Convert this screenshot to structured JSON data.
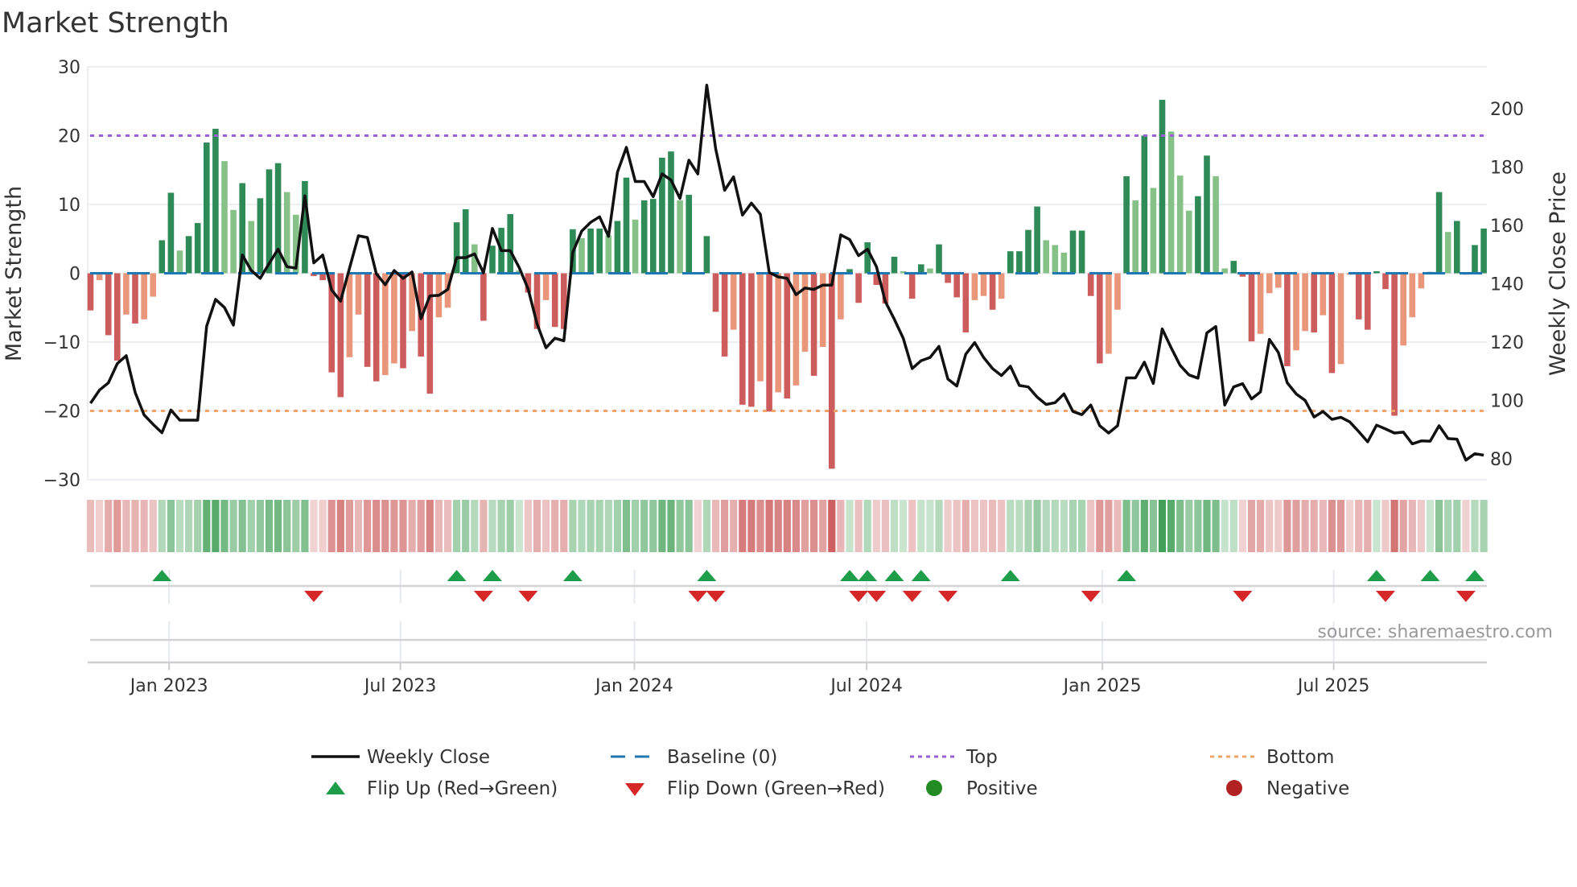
{
  "title": "Market Strength",
  "source": "source: sharemaestro.com",
  "chart_data": {
    "type": "bar",
    "title": "Market Strength",
    "ylabel": "Market Strength",
    "ylabel_right": "Weekly Close Price",
    "ylim": [
      -30,
      30
    ],
    "ylim_right": [
      72.8,
      214.3
    ],
    "yticks": [
      {
        "v": 30,
        "label": "30"
      },
      {
        "v": 20,
        "label": "20"
      },
      {
        "v": 10,
        "label": "10"
      },
      {
        "v": 0,
        "label": "0"
      },
      {
        "v": -10,
        "label": "−10"
      },
      {
        "v": -20,
        "label": "−20"
      },
      {
        "v": -30,
        "label": "−30"
      }
    ],
    "yticks_right": [
      {
        "v": 200,
        "label": "200"
      },
      {
        "v": 180,
        "label": "180"
      },
      {
        "v": 160,
        "label": "160"
      },
      {
        "v": 140,
        "label": "140"
      },
      {
        "v": 120,
        "label": "120"
      },
      {
        "v": 100,
        "label": "100"
      },
      {
        "v": 80,
        "label": "80"
      }
    ],
    "x_unit": "week index",
    "xticks": [
      {
        "x": 8.8,
        "label": "Jan 2023"
      },
      {
        "x": 34.7,
        "label": "Jul 2023"
      },
      {
        "x": 60.9,
        "label": "Jan 2024"
      },
      {
        "x": 86.9,
        "label": "Jul 2024"
      },
      {
        "x": 113.3,
        "label": "Jan 2025"
      },
      {
        "x": 139.2,
        "label": "Jul 2025"
      }
    ],
    "top_level": 20,
    "bottom_level": -20,
    "baseline": 0,
    "strength": [
      -5.4,
      -1,
      -9,
      -12.7,
      -6,
      -7.3,
      -6.7,
      -3.4,
      4.8,
      11.7,
      3.3,
      5.4,
      7.3,
      19,
      21,
      16.3,
      9.2,
      13.1,
      7.6,
      10.9,
      15.1,
      16,
      11.8,
      8.5,
      13.4,
      -0.4,
      -1,
      -14.4,
      -18,
      -12.2,
      -6,
      -13.6,
      -15.7,
      -14.8,
      -13.1,
      -13.8,
      -8.4,
      -12.1,
      -17.5,
      -6.4,
      -5,
      7.4,
      9.3,
      4.2,
      -6.9,
      4,
      6.6,
      8.6,
      0.4,
      -2.8,
      -8.1,
      -3.9,
      -7.8,
      -8.1,
      6.4,
      5.1,
      6.5,
      6.5,
      5.5,
      7.6,
      13.9,
      7.8,
      10.6,
      10.8,
      16.8,
      17.7,
      10.6,
      11.4,
      -0.1,
      5.4,
      -5.6,
      -12.1,
      -8.2,
      -19.1,
      -19.4,
      -15.7,
      -20.1,
      -17.3,
      -18.2,
      -16.3,
      -11.4,
      -14.9,
      -10.7,
      -28.4,
      -6.7,
      0.6,
      -4.3,
      4.5,
      -1.7,
      -4.4,
      2.4,
      0.3,
      -3.7,
      1.3,
      0.7,
      4.2,
      -1.4,
      -3.5,
      -8.6,
      -3.9,
      -3.3,
      -5.3,
      -3.7,
      3.2,
      3.2,
      6.3,
      9.7,
      4.8,
      4.1,
      3.0,
      6.2,
      6.2,
      -3.3,
      -13.1,
      -11.7,
      -5.3,
      14.1,
      10.6,
      20.0,
      12.4,
      25.2,
      20.6,
      14.2,
      9.1,
      11.2,
      17.1,
      14.1,
      0.7,
      1.8,
      -0.5,
      -9.9,
      -8.8,
      -2.9,
      -2.1,
      -13.5,
      -11.2,
      -8.4,
      -8.6,
      -6.1,
      -14.5,
      -13.2,
      -0.2,
      -6.7,
      -8.2,
      0.3,
      -2.3,
      -20.7,
      -10.5,
      -6.4,
      -2.2,
      0.2,
      11.8,
      6.0,
      7.6,
      -0.2,
      4.1,
      6.5
    ],
    "weekly_close": [
      99,
      103.5,
      106,
      112.6,
      115.3,
      102.7,
      95,
      91.8,
      88.9,
      96.7,
      93.2,
      93.2,
      93.2,
      125.4,
      134.6,
      131.8,
      125.8,
      149.8,
      144.5,
      141.8,
      146.9,
      151.8,
      145.8,
      145.3,
      170.1,
      147.1,
      149.8,
      137.8,
      134,
      145.3,
      156.4,
      155.8,
      143.4,
      139.6,
      144.5,
      141.8,
      144,
      128,
      135.8,
      136,
      138,
      148.9,
      148.9,
      150.2,
      143.7,
      158.9,
      151.3,
      151.3,
      145.5,
      138.2,
      126.2,
      118,
      121.3,
      120.4,
      150.7,
      158,
      161,
      162.9,
      156.2,
      178.2,
      186.7,
      175,
      175,
      169.8,
      177.6,
      175.5,
      169.2,
      182.3,
      177.6,
      208,
      186.2,
      172,
      176.6,
      163.5,
      167.6,
      163.8,
      143.8,
      142.3,
      141.8,
      136.2,
      138.5,
      138,
      139.5,
      139.5,
      156.7,
      155.1,
      149.6,
      151.8,
      145.8,
      133.8,
      127.8,
      121.3,
      110.9,
      113.6,
      114.7,
      118.5,
      107.3,
      104.9,
      115.8,
      119.8,
      114.7,
      110.9,
      108.5,
      111.7,
      105.1,
      104.6,
      101.1,
      98.6,
      99.2,
      102.2,
      96.2,
      95.1,
      98.4,
      91.3,
      88.8,
      91.3,
      107.7,
      107.7,
      113.1,
      105.8,
      124.5,
      118,
      112,
      108.7,
      107.6,
      123.1,
      125.3,
      98.4,
      104.6,
      105.7,
      100.5,
      102.9,
      120.9,
      116.4,
      106,
      102.2,
      100,
      94.3,
      96.2,
      93.5,
      94.2,
      92.6,
      89.3,
      85.8,
      91.5,
      90.2,
      88.8,
      89.1,
      85.1,
      86.1,
      86,
      91.3,
      86.9,
      86.7,
      79.5,
      81.7,
      81.2
    ],
    "flip_up": [
      8,
      41,
      45,
      54,
      69,
      85,
      87,
      90,
      93,
      103,
      116,
      144,
      150,
      155
    ],
    "flip_down": [
      25,
      44,
      49,
      68,
      70,
      86,
      88,
      92,
      96,
      112,
      129,
      145,
      154
    ],
    "colors": {
      "pos_strong": "#2e8b57",
      "pos_weak": "#86c287",
      "neg_strong": "#cd5c5c",
      "neg_weak": "#e9967a",
      "close": "#111111",
      "baseline": "#1f77b4",
      "top": "#9b5fd6",
      "bottom": "#f2a465",
      "flip_up": "#1e9e4a",
      "flip_down": "#d62728",
      "positive": "#228b22",
      "negative": "#b22222"
    },
    "legend": {
      "placement": "bottom",
      "items": [
        {
          "label": "Weekly Close"
        },
        {
          "label": "Baseline (0)"
        },
        {
          "label": "Top"
        },
        {
          "label": "Bottom"
        },
        {
          "label": "Flip Up (Red→Green)"
        },
        {
          "label": "Flip Down (Green→Red)"
        },
        {
          "label": "Positive"
        },
        {
          "label": "Negative"
        }
      ]
    }
  }
}
